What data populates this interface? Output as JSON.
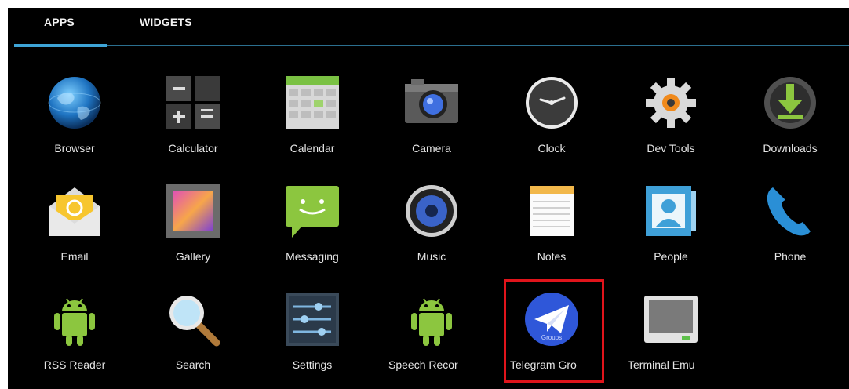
{
  "tabs": {
    "apps_label": "APPS",
    "widgets_label": "WIDGETS",
    "active": "APPS"
  },
  "apps": [
    {
      "label": "Browser",
      "icon": "browser-icon"
    },
    {
      "label": "Calculator",
      "icon": "calculator-icon"
    },
    {
      "label": "Calendar",
      "icon": "calendar-icon"
    },
    {
      "label": "Camera",
      "icon": "camera-icon"
    },
    {
      "label": "Clock",
      "icon": "clock-icon"
    },
    {
      "label": "Dev Tools",
      "icon": "gear-icon"
    },
    {
      "label": "Downloads",
      "icon": "download-icon"
    },
    {
      "label": "Email",
      "icon": "email-icon"
    },
    {
      "label": "Gallery",
      "icon": "gallery-icon"
    },
    {
      "label": "Messaging",
      "icon": "messaging-icon"
    },
    {
      "label": "Music",
      "icon": "speaker-icon"
    },
    {
      "label": "Notes",
      "icon": "notes-icon"
    },
    {
      "label": "People",
      "icon": "contacts-icon"
    },
    {
      "label": "Phone",
      "icon": "phone-icon"
    },
    {
      "label": "RSS Reader",
      "icon": "android-icon"
    },
    {
      "label": "Search",
      "icon": "magnifier-icon"
    },
    {
      "label": "Settings",
      "icon": "settings-icon"
    },
    {
      "label": "Speech Recor",
      "icon": "android-icon"
    },
    {
      "label": "Telegram Gro",
      "icon": "telegram-icon",
      "icon_text": "Groups"
    },
    {
      "label": "Terminal Emu",
      "icon": "terminal-icon"
    }
  ],
  "colors": {
    "accent": "#3ea4d6",
    "highlight": "#e0141b",
    "background": "#000000"
  }
}
